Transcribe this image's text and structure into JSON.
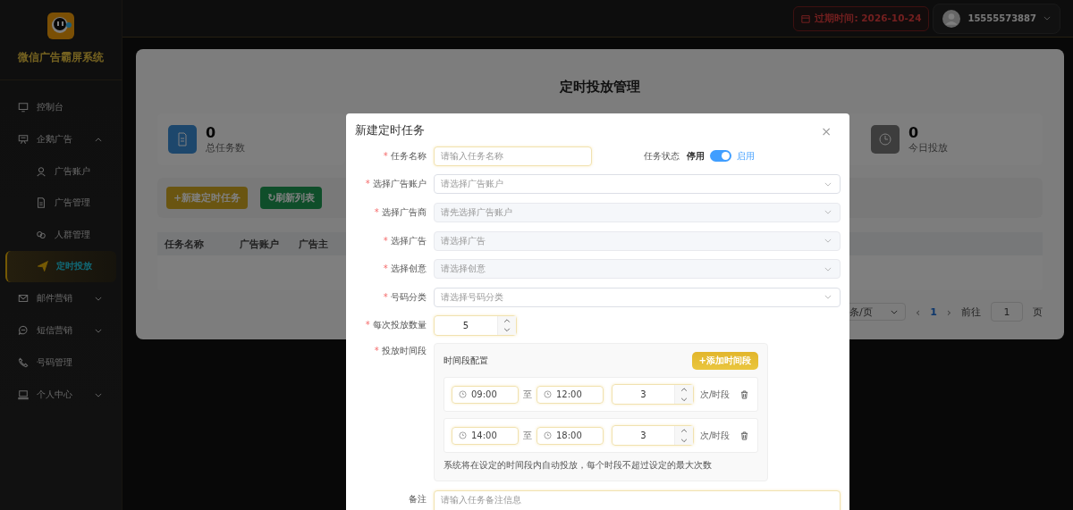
{
  "sidebar": {
    "title": "微信广告霸屏系统",
    "items": [
      {
        "label": "控制台",
        "kind": "monitor",
        "selected": false
      },
      {
        "label": "企鹅广告",
        "kind": "board",
        "selected": false,
        "expanded": true,
        "children": [
          {
            "label": "广告账户",
            "kind": "user",
            "selected": false
          },
          {
            "label": "广告管理",
            "kind": "doc",
            "selected": false
          },
          {
            "label": "人群管理",
            "kind": "rings",
            "selected": false
          },
          {
            "label": "定时投放",
            "kind": "plane",
            "selected": true
          }
        ]
      },
      {
        "label": "邮件营销",
        "kind": "mail",
        "selected": false,
        "expanded": false
      },
      {
        "label": "短信营销",
        "kind": "chat",
        "selected": false,
        "expanded": false
      },
      {
        "label": "号码管理",
        "kind": "phone",
        "selected": false
      },
      {
        "label": "个人中心",
        "kind": "desk",
        "selected": false,
        "expanded": false
      }
    ]
  },
  "topbar": {
    "expiry": "过期时间: 2026-10-24",
    "user": "15555573887"
  },
  "page": {
    "title": "定时投放管理",
    "stats": [
      {
        "value": "0",
        "label": "总任务数",
        "kind": "doc"
      },
      {
        "value": "0",
        "label": "今日投放",
        "kind": "clock"
      }
    ],
    "buttons": [
      {
        "label": "+新建定时任务",
        "kind": "add"
      },
      {
        "label": "↻刷新列表",
        "kind": "refresh"
      }
    ],
    "columns": [
      "任务名称",
      "广告账户",
      "广告主"
    ],
    "pagination": {
      "page_size": "条/页",
      "prev": "‹",
      "current": "1",
      "next": "›",
      "goto": "前往",
      "goto_value": "1",
      "page_unit": "页"
    }
  },
  "dialog": {
    "title": "新建定时任务",
    "close": "×",
    "task_name": {
      "label": "任务名称",
      "required_mark": "*",
      "placeholder": "请输入任务名称"
    },
    "status": {
      "label": "任务状态",
      "off_label": "停用",
      "on_label": "启用",
      "on": true
    },
    "selects": [
      {
        "label": "选择广告账户",
        "required_mark": "*",
        "placeholder": "请选择广告账户",
        "disabled": false
      },
      {
        "label": "选择广告商",
        "required_mark": "*",
        "placeholder": "请先选择广告账户",
        "disabled": true
      },
      {
        "label": "选择广告",
        "required_mark": "*",
        "placeholder": "请选择广告",
        "disabled": true
      },
      {
        "label": "选择创意",
        "required_mark": "*",
        "placeholder": "请选择创意",
        "disabled": true
      },
      {
        "label": "号码分类",
        "required_mark": "*",
        "placeholder": "请选择号码分类",
        "disabled": false
      }
    ],
    "quantity": {
      "label": "每次投放数量",
      "required_mark": "*",
      "value": "5"
    },
    "schedule": {
      "label": "投放时间段",
      "required_mark": "*",
      "heading": "时间段配置",
      "add_button": "+添加时间段",
      "slots": [
        {
          "start": "09:00",
          "separator": "至",
          "end": "12:00",
          "count": "3",
          "unit": "次/时段"
        },
        {
          "start": "14:00",
          "separator": "至",
          "end": "18:00",
          "count": "3",
          "unit": "次/时段"
        }
      ],
      "hint": "系统将在设定的时间段内自动投放，每个时段不超过设定的最大次数"
    },
    "remark": {
      "label": "备注",
      "placeholder": "请输入任务备注信息"
    }
  }
}
